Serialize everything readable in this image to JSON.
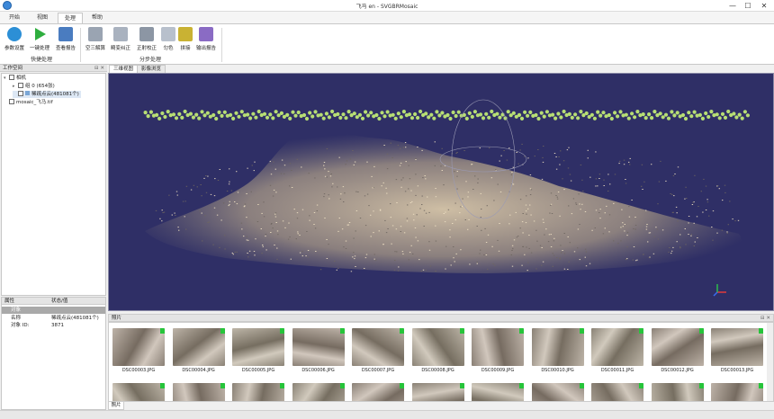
{
  "window": {
    "title": "飞马 en - SVGBRMosaic",
    "minimize": "—",
    "maximize": "☐",
    "close": "✕"
  },
  "tabs": [
    {
      "label": "开始",
      "active": false
    },
    {
      "label": "视图",
      "active": false
    },
    {
      "label": "处理",
      "active": true
    },
    {
      "label": "帮助",
      "active": false
    }
  ],
  "ribbon": {
    "group1": {
      "label": "快捷处理",
      "buttons": [
        {
          "label": "参数设置",
          "icon": "gear-globe-icon",
          "color": "#2c8fd6"
        },
        {
          "label": "一键处理",
          "icon": "play-icon",
          "color": "#2fae3f"
        },
        {
          "label": "查看报告",
          "icon": "report-icon",
          "color": "#4a7cc0"
        }
      ]
    },
    "group2": {
      "label": "分步处理",
      "buttons": [
        {
          "label": "空三解算",
          "icon": "aerotriangulation-icon",
          "color": "#9aa4b2"
        },
        {
          "label": "畸变纠正",
          "icon": "grid-correct-icon",
          "color": "#a9b2bf"
        },
        {
          "label": "正射校正",
          "icon": "ortho-icon",
          "color": "#8c96a4"
        },
        {
          "label": "匀色",
          "icon": "color-balance-icon",
          "color": "#b8c0cc"
        },
        {
          "label": "拼接",
          "icon": "mosaic-icon",
          "color": "#c9b233"
        },
        {
          "label": "输出报告",
          "icon": "export-report-icon",
          "color": "#8a6bc4"
        }
      ]
    }
  },
  "workspace": {
    "header": "工作空间",
    "tree": [
      {
        "label": "相机",
        "level": 0,
        "expander": "▾"
      },
      {
        "label": "组 0 (654张)",
        "level": 1,
        "expander": "▸"
      },
      {
        "label": "稀疏点云(481081个)",
        "level": 1,
        "expander": ""
      },
      {
        "label": "mosaic_飞马.tif",
        "level": 0,
        "expander": ""
      }
    ]
  },
  "properties": {
    "col1": "属性",
    "col2": "状态/值",
    "section": "对象",
    "rows": [
      {
        "key": "名称",
        "value": "稀疏点云(481081个)"
      },
      {
        "key": "对象 ID:",
        "value": "3871"
      }
    ]
  },
  "view_tabs": [
    {
      "label": "三维视图",
      "active": true
    },
    {
      "label": "影像浏览",
      "active": false
    }
  ],
  "photos": {
    "header": "照片",
    "bottom_tab": "照片",
    "row1": [
      "DSC00003.JPG",
      "DSC00004.JPG",
      "DSC00005.JPG",
      "DSC00006.JPG",
      "DSC00007.JPG",
      "DSC00008.JPG",
      "DSC00009.JPG",
      "DSC00010.JPG",
      "DSC00011.JPG",
      "DSC00012.JPG",
      "DSC00013.JPG"
    ],
    "row2_count": 11
  },
  "colors": {
    "viewport_bg": "#2f2f66",
    "camera_point": "#b7de74",
    "status_flag": "#26c43a",
    "accent": "#3c88d8"
  }
}
